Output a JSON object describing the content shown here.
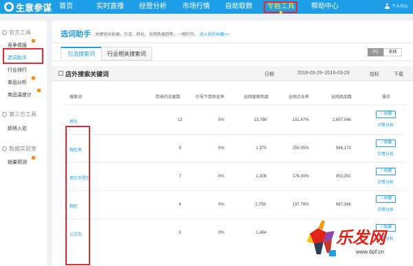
{
  "app": {
    "title": "生意参谋"
  },
  "nav": {
    "items": [
      {
        "label": "首页",
        "active": false
      },
      {
        "label": "实时直播",
        "active": false
      },
      {
        "label": "经营分析",
        "active": false
      },
      {
        "label": "市场行情",
        "active": false
      },
      {
        "label": "自助取数",
        "active": false
      },
      {
        "label": "专题工具",
        "active": true
      },
      {
        "label": "帮助中心",
        "active": false
      }
    ],
    "user_label": "个人中心"
  },
  "sidebar": {
    "sections": [
      {
        "label": "官方工具"
      },
      {
        "label": "第三方工具"
      },
      {
        "label": "数据实验室"
      }
    ],
    "items": [
      {
        "label": "竞争情报"
      },
      {
        "label": "选词助手"
      },
      {
        "label": "行业排行"
      },
      {
        "label": "单品分析"
      },
      {
        "label": "商品温度计"
      },
      {
        "label": "即将入驻"
      },
      {
        "label": "销量预测"
      }
    ]
  },
  "main": {
    "title": "选词助手",
    "desc": "关键词分析器，引流、转化、全网热搜趋势，一网打尽。",
    "desc_link": "进入我的收藏>>",
    "tabs": [
      {
        "label": "引流搜索词"
      },
      {
        "label": "行业相关搜索词"
      }
    ],
    "toggles": [
      {
        "label": "PC"
      },
      {
        "label": "无线"
      }
    ],
    "section_title": "店外搜索关键词",
    "date_label": "日期",
    "date_range": "2016-03-29~2016-03-29",
    "metric_label": "指标",
    "download_label": "下载"
  },
  "table": {
    "headers": [
      "搜索词",
      "带来的访客数",
      "引导下单转化率",
      "全网搜索热度",
      "全网点击率",
      "全网商品数",
      "操作"
    ],
    "rows": [
      {
        "keyword": "男包",
        "visitors": "13",
        "conversion": "0%",
        "heat": "13,786",
        "ctr": "151.47%",
        "products": "2,657,046"
      },
      {
        "keyword": "胸包男",
        "visitors": "9",
        "conversion": "0%",
        "heat": "1,370",
        "ctr": "250.05%",
        "products": "544,173"
      },
      {
        "keyword": "男包手提包",
        "visitors": "7",
        "conversion": "0%",
        "heat": "1,308",
        "ctr": "176.30%",
        "products": "953,291"
      },
      {
        "keyword": "胸包",
        "visitors": "6",
        "conversion": "0%",
        "heat": "2,759",
        "ctr": "197.78%",
        "products": "687,346"
      },
      {
        "keyword": "公文包",
        "visitors": "5",
        "conversion": "0%",
        "heat": "1,464",
        "ctr": "",
        "products": ""
      }
    ],
    "action_label": "收藏",
    "detail_label": "详情分析"
  },
  "watermark": {
    "brand": "乐发网",
    "url": "www.6pf.cn"
  },
  "colors": {
    "nav_bg": "#1e9ee6",
    "accent": "#1e9ee6",
    "highlight_box": "#e4292b",
    "nav_active": "#ffe14c",
    "badge": "#ff8c1a"
  }
}
